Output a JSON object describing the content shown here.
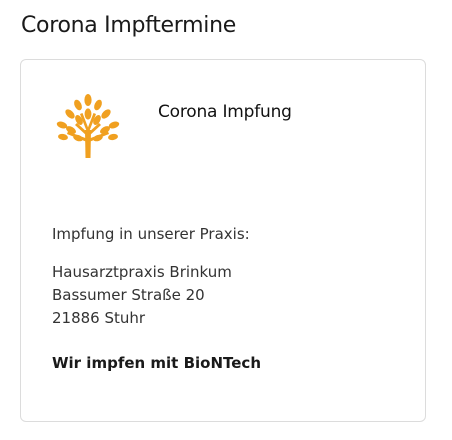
{
  "page": {
    "title": "Corona Impftermine"
  },
  "card": {
    "logo_icon": "tree-logo-icon",
    "title": "Corona Impfung",
    "intro": "Impfung in unserer Praxis:",
    "address": {
      "name": "Hausarztpraxis Brinkum",
      "street": "Bassumer Straße 20",
      "city": "21886 Stuhr"
    },
    "vaccine_note": "Wir impfen mit BioNTech"
  },
  "colors": {
    "accent": "#f0a020",
    "border": "#dcdcdc",
    "text": "#333333"
  }
}
